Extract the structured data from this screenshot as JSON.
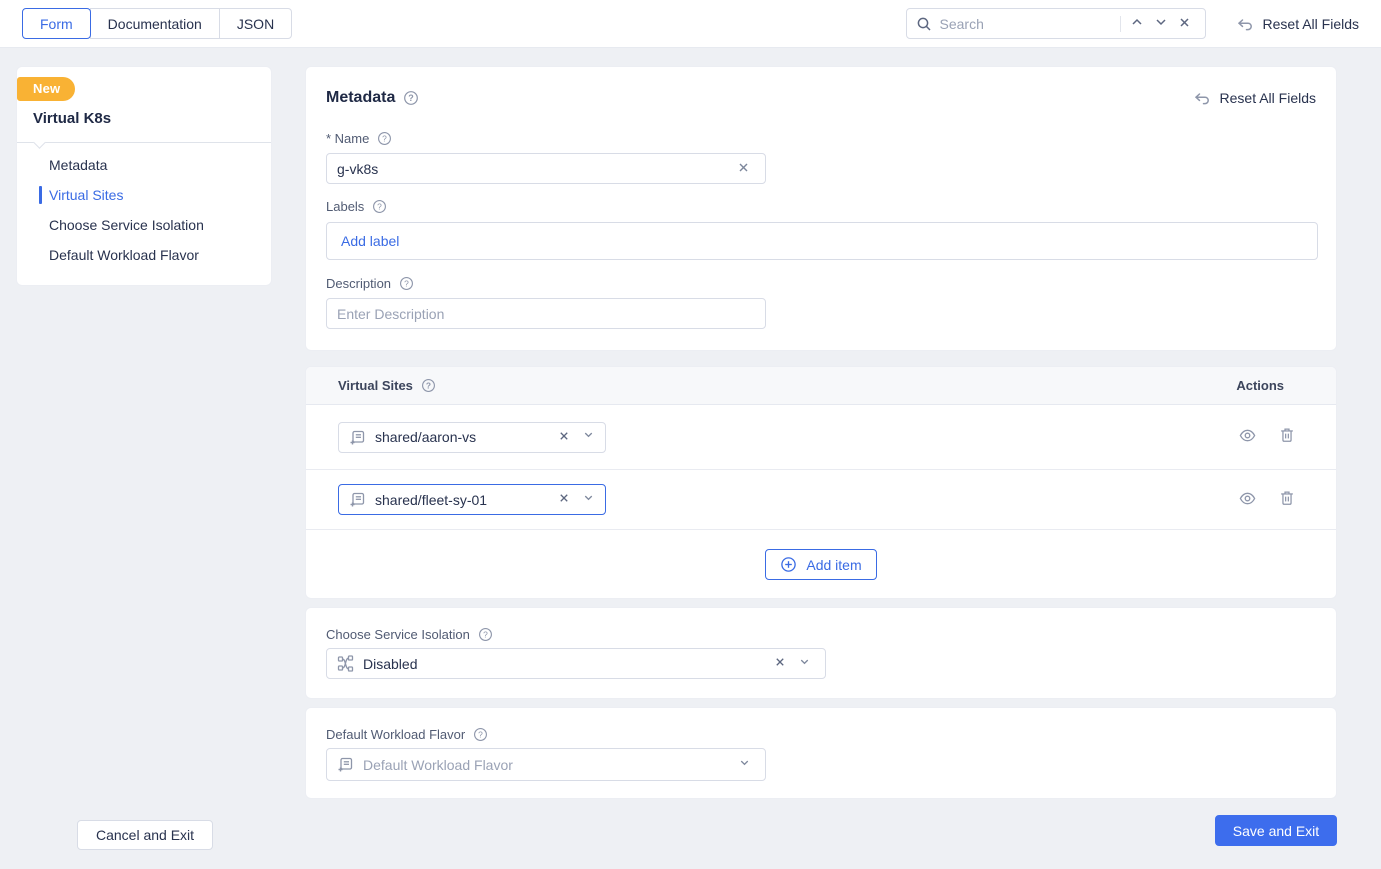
{
  "topbar": {
    "tabs": [
      {
        "label": "Form",
        "active": true
      },
      {
        "label": "Documentation",
        "active": false
      },
      {
        "label": "JSON",
        "active": false
      }
    ],
    "search": {
      "placeholder": "Search"
    },
    "reset_label": "Reset All Fields"
  },
  "sidebar": {
    "badge": "New",
    "title": "Virtual K8s",
    "items": [
      {
        "label": "Metadata",
        "active": false
      },
      {
        "label": "Virtual Sites",
        "active": true
      },
      {
        "label": "Choose Service Isolation",
        "active": false
      },
      {
        "label": "Default Workload Flavor",
        "active": false
      }
    ]
  },
  "metadata": {
    "title": "Metadata",
    "reset_label": "Reset All Fields",
    "name": {
      "label": "* Name",
      "value": "g-vk8s"
    },
    "labels": {
      "label": "Labels",
      "add_label": "Add label"
    },
    "description": {
      "label": "Description",
      "placeholder": "Enter Description"
    }
  },
  "virtual_sites": {
    "title": "Virtual Sites",
    "actions_header": "Actions",
    "rows": [
      {
        "value": "shared/aaron-vs"
      },
      {
        "value": "shared/fleet-sy-01"
      }
    ],
    "add_item_label": "Add item"
  },
  "service_isolation": {
    "label": "Choose Service Isolation",
    "value": "Disabled"
  },
  "workload_flavor": {
    "label": "Default Workload Flavor",
    "placeholder": "Default Workload Flavor"
  },
  "footer": {
    "cancel_label": "Cancel and Exit",
    "save_label": "Save and Exit"
  },
  "colors": {
    "accent_blue": "#3A6BE4",
    "save_button_blue": "#3D6DED",
    "badge_orange": "#F9B234",
    "page_background": "#EEF0F4",
    "section_header_bg": "#F7F8FA"
  }
}
